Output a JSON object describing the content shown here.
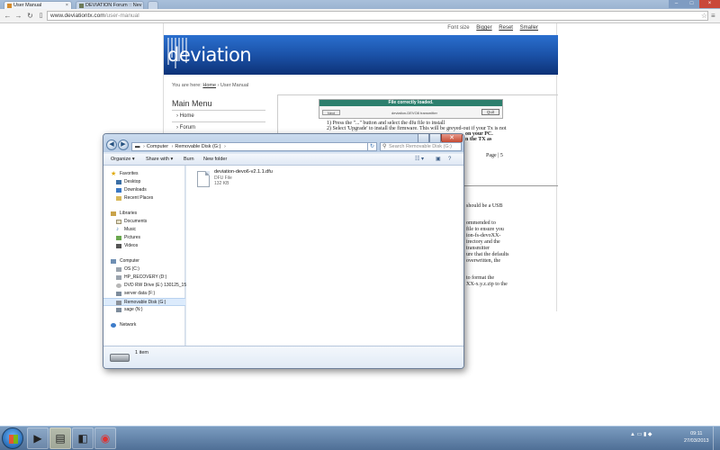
{
  "browser": {
    "tabs": [
      {
        "label": "User Manual",
        "active": true
      },
      {
        "label": "DEVIATION Forum :: Nev",
        "active": false
      }
    ],
    "url_prefix": "www.deviationtx.com",
    "url_path": "/user-manual"
  },
  "site": {
    "font_size_label": "Font size",
    "font_links": [
      "Bigger",
      "Reset",
      "Smaller"
    ],
    "logo_dev": "dev",
    "logo_iation": "iation",
    "breadcrumb_prefix": "You are here:",
    "breadcrumb_home": "Home",
    "breadcrumb_current": "User Manual",
    "main_menu_title": "Main Menu",
    "menu_items": [
      "Home",
      "Forum"
    ],
    "doc": {
      "dialog_bar": "File correctly loaded.",
      "dialog_button_left": "Next",
      "dialog_filename": "deviation-DEVO8 transmitter",
      "dialog_button_right": "Quit",
      "step1": "1)  Press the \"...\" button and select the dfu file to install",
      "step2": "2)  Select 'Upgrade' to install the firmware.  This will be greyed-out if your Tx is not",
      "step2b": "on your PC.",
      "step2c": "n the TX as",
      "page": "Page | 5",
      "frag1": "should be a USB",
      "frag2": "ommended to",
      "frag3": "file to ensure you",
      "frag4": "ion-fs-devoXX-",
      "frag5": "irectory and the",
      "frag6": "transmitter",
      "frag7": "ure that the defaults",
      "frag8": "overwritten, the",
      "frag9": "to format the",
      "frag10": "XX-x.y.z.zip to the"
    }
  },
  "explorer": {
    "address": [
      "Computer",
      "Removable Disk (G:)"
    ],
    "search_placeholder": "Search Removable Disk (G:)",
    "commands": [
      "Organize ▾",
      "Share with ▾",
      "Burn",
      "New folder"
    ],
    "nav": [
      {
        "label": "Favorites",
        "level": 0,
        "icon": "star-icon"
      },
      {
        "label": "Desktop",
        "level": 1,
        "icon": "desktop-icon"
      },
      {
        "label": "Downloads",
        "level": 1,
        "icon": "downloads-icon"
      },
      {
        "label": "Recent Places",
        "level": 1,
        "icon": "recent-places-icon"
      },
      {
        "label": "Libraries",
        "level": 0,
        "icon": "libraries-icon"
      },
      {
        "label": "Documents",
        "level": 1,
        "icon": "documents-icon"
      },
      {
        "label": "Music",
        "level": 1,
        "icon": "music-icon"
      },
      {
        "label": "Pictures",
        "level": 1,
        "icon": "pictures-icon"
      },
      {
        "label": "Videos",
        "level": 1,
        "icon": "videos-icon"
      },
      {
        "label": "Computer",
        "level": 0,
        "icon": "computer-icon"
      },
      {
        "label": "OS (C:)",
        "level": 1,
        "icon": "drive-icon"
      },
      {
        "label": "HP_RECOVERY (D:)",
        "level": 1,
        "icon": "drive-icon"
      },
      {
        "label": "DVD RW Drive (E:) 130125_1539",
        "level": 1,
        "icon": "dvd-drive-icon"
      },
      {
        "label": "server data (F:)",
        "level": 1,
        "icon": "network-drive-icon"
      },
      {
        "label": "Removable Disk (G:)",
        "level": 1,
        "icon": "removable-disk-icon",
        "selected": true
      },
      {
        "label": "sage (N:)",
        "level": 1,
        "icon": "network-drive-icon"
      },
      {
        "label": "Network",
        "level": 0,
        "icon": "network-icon"
      }
    ],
    "file": {
      "name": "deviation-devo6-v2.1.1.dfu",
      "type": "DFU File",
      "size": "132 KB"
    },
    "status": "1 item"
  },
  "taskbar": {
    "clock_time": "09:11",
    "clock_date": "27/03/2013"
  }
}
